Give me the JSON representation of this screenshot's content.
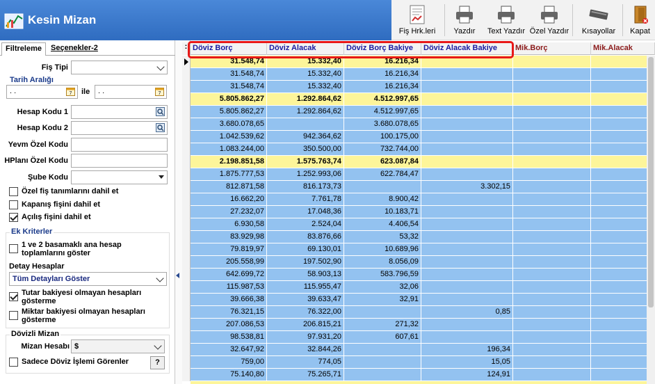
{
  "window": {
    "title": "Kesin Mizan"
  },
  "toolbar": {
    "buttons": [
      {
        "label": "Fiş Hrk.leri",
        "icon": "document-chart-icon"
      },
      {
        "label": "Yazdır",
        "icon": "printer-icon"
      },
      {
        "label": "Text Yazdır",
        "icon": "printer-icon"
      },
      {
        "label": "Özel Yazdır",
        "icon": "printer-icon"
      },
      {
        "label": "Kısayollar",
        "icon": "keyboard-icon"
      },
      {
        "label": "Kapat",
        "icon": "close-door-icon"
      }
    ]
  },
  "tabs": [
    "Filtreleme",
    "Seçenekler-2"
  ],
  "filters": {
    "fis_tipi_label": "Fiş Tipi",
    "fis_tipi_value": "",
    "tarih_araligi_title": "Tarih Aralığı",
    "date_start": " .  . ",
    "date_end": " .  . ",
    "date_sep": "ile",
    "hesap_kodu1_label": "Hesap Kodu 1",
    "hesap_kodu2_label": "Hesap Kodu 2",
    "yevm_label": "Yevm Özel Kodu",
    "hplani_label": "HPlanı Özel Kodu",
    "sube_label": "Şube Kodu",
    "chk_ozel_fis": "Özel fiş tanımlarını dahil et",
    "chk_kapanis": "Kapanış fişini dahil et",
    "chk_acilis": "Açılış fişini dahil et",
    "ek_kriterler_title": "Ek Kriterler",
    "chk_basamak_1": "1 ve 2 basamaklı ana hesap",
    "chk_basamak_2": "toplamlarını göster",
    "detay_label": "Detay Hesaplar",
    "detay_value": "Tüm Detayları Göster",
    "chk_tutar_1": "Tutar bakiyesi olmayan hesapları",
    "chk_tutar_2": "gösterme",
    "chk_miktar_1": "Miktar bakiyesi olmayan hesapları",
    "chk_miktar_2": "gösterme",
    "dovizli_title": "Dövizli Mizan",
    "mizan_hesabi_label": "Mizan Hesabı",
    "mizan_hesabi_value": "$",
    "chk_sadece_doviz": "Sadece Döviz İşlemi Görenler",
    "help_label": "?"
  },
  "checks": {
    "ozel_fis": false,
    "kapanis": false,
    "acilis": true,
    "basamak": false,
    "tutar": true,
    "miktar": false,
    "sadece_doviz": false
  },
  "grid": {
    "headers": [
      "Döviz Borç",
      "Döviz Alacak",
      "Döviz Borç Bakiye",
      "Döviz Alacak Bakiye",
      "Mik.Borç",
      "Mik.Alacak"
    ],
    "header_colors": [
      "#1a1aa0",
      "#1a1aa0",
      "#1a1aa0",
      "#1a1aa0",
      "#8b1a1a",
      "#8b1a1a"
    ],
    "row_colors": {
      "yellow": "#fdf59a",
      "blue": "#93c2f0"
    },
    "rows": [
      {
        "c": [
          "31.548,74",
          "15.332,40",
          "16.216,34",
          "",
          "",
          ""
        ],
        "hl": "yellow",
        "bold": true
      },
      {
        "c": [
          "31.548,74",
          "15.332,40",
          "16.216,34",
          "",
          "",
          ""
        ],
        "hl": "blue",
        "bold": false
      },
      {
        "c": [
          "31.548,74",
          "15.332,40",
          "16.216,34",
          "",
          "",
          ""
        ],
        "hl": "blue",
        "bold": false
      },
      {
        "c": [
          "5.805.862,27",
          "1.292.864,62",
          "4.512.997,65",
          "",
          "",
          ""
        ],
        "hl": "yellow",
        "bold": true
      },
      {
        "c": [
          "5.805.862,27",
          "1.292.864,62",
          "4.512.997,65",
          "",
          "",
          ""
        ],
        "hl": "blue",
        "bold": false
      },
      {
        "c": [
          "3.680.078,65",
          "",
          "3.680.078,65",
          "",
          "",
          ""
        ],
        "hl": "blue",
        "bold": false
      },
      {
        "c": [
          "1.042.539,62",
          "942.364,62",
          "100.175,00",
          "",
          "",
          ""
        ],
        "hl": "blue",
        "bold": false
      },
      {
        "c": [
          "1.083.244,00",
          "350.500,00",
          "732.744,00",
          "",
          "",
          ""
        ],
        "hl": "blue",
        "bold": false
      },
      {
        "c": [
          "2.198.851,58",
          "1.575.763,74",
          "623.087,84",
          "",
          "",
          ""
        ],
        "hl": "yellow",
        "bold": true
      },
      {
        "c": [
          "1.875.777,53",
          "1.252.993,06",
          "622.784,47",
          "",
          "",
          ""
        ],
        "hl": "blue",
        "bold": false
      },
      {
        "c": [
          "812.871,58",
          "816.173,73",
          "",
          "3.302,15",
          "",
          ""
        ],
        "hl": "blue",
        "bold": false
      },
      {
        "c": [
          "16.662,20",
          "7.761,78",
          "8.900,42",
          "",
          "",
          ""
        ],
        "hl": "blue",
        "bold": false
      },
      {
        "c": [
          "27.232,07",
          "17.048,36",
          "10.183,71",
          "",
          "",
          ""
        ],
        "hl": "blue",
        "bold": false
      },
      {
        "c": [
          "6.930,58",
          "2.524,04",
          "4.406,54",
          "",
          "",
          ""
        ],
        "hl": "blue",
        "bold": false
      },
      {
        "c": [
          "83.929,98",
          "83.876,66",
          "53,32",
          "",
          "",
          ""
        ],
        "hl": "blue",
        "bold": false
      },
      {
        "c": [
          "79.819,97",
          "69.130,01",
          "10.689,96",
          "",
          "",
          ""
        ],
        "hl": "blue",
        "bold": false
      },
      {
        "c": [
          "205.558,99",
          "197.502,90",
          "8.056,09",
          "",
          "",
          ""
        ],
        "hl": "blue",
        "bold": false
      },
      {
        "c": [
          "642.699,72",
          "58.903,13",
          "583.796,59",
          "",
          "",
          ""
        ],
        "hl": "blue",
        "bold": false
      },
      {
        "c": [
          "115.987,53",
          "115.955,47",
          "32,06",
          "",
          "",
          ""
        ],
        "hl": "blue",
        "bold": false
      },
      {
        "c": [
          "39.666,38",
          "39.633,47",
          "32,91",
          "",
          "",
          ""
        ],
        "hl": "blue",
        "bold": false
      },
      {
        "c": [
          "76.321,15",
          "76.322,00",
          "",
          "0,85",
          "",
          ""
        ],
        "hl": "blue",
        "bold": false
      },
      {
        "c": [
          "207.086,53",
          "206.815,21",
          "271,32",
          "",
          "",
          ""
        ],
        "hl": "blue",
        "bold": false
      },
      {
        "c": [
          "98.538,81",
          "97.931,20",
          "607,61",
          "",
          "",
          ""
        ],
        "hl": "blue",
        "bold": false
      },
      {
        "c": [
          "32.647,92",
          "32.844,26",
          "",
          "196,34",
          "",
          ""
        ],
        "hl": "blue",
        "bold": false
      },
      {
        "c": [
          "759,00",
          "774,05",
          "",
          "15,05",
          "",
          ""
        ],
        "hl": "blue",
        "bold": false
      },
      {
        "c": [
          "75.140,80",
          "75.265,71",
          "",
          "124,91",
          "",
          ""
        ],
        "hl": "blue",
        "bold": false
      }
    ]
  }
}
